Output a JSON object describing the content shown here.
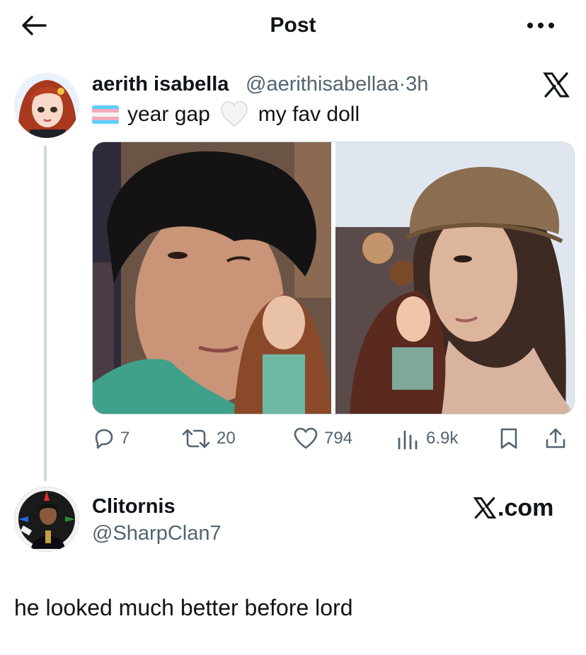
{
  "header": {
    "title": "Post",
    "back_icon": "arrow-left-icon",
    "more_icon": "ellipsis-icon"
  },
  "tweet": {
    "author_name": "aerith isabella",
    "author_handle": "@aerithisabellaa",
    "separator": "·",
    "timestamp": "3h",
    "text_part1": "year gap",
    "text_part2": "my fav doll",
    "emoji_flag": "transgender-flag",
    "emoji_heart": "white-heart",
    "brand_icon": "x-logo-icon",
    "actions": {
      "replies": "7",
      "reposts": "20",
      "likes": "794",
      "views": "6.9k"
    }
  },
  "reply": {
    "author_name": "Clitornis",
    "author_handle": "@SharpClan7",
    "brand_text": ".com",
    "text": "he looked much better before lord"
  },
  "colors": {
    "text": "#0f1419",
    "secondary": "#536471",
    "divider": "#cfd9de",
    "flag_blue": "#5bcefa",
    "flag_pink": "#f5a9b8",
    "flag_white": "#ffffff"
  }
}
